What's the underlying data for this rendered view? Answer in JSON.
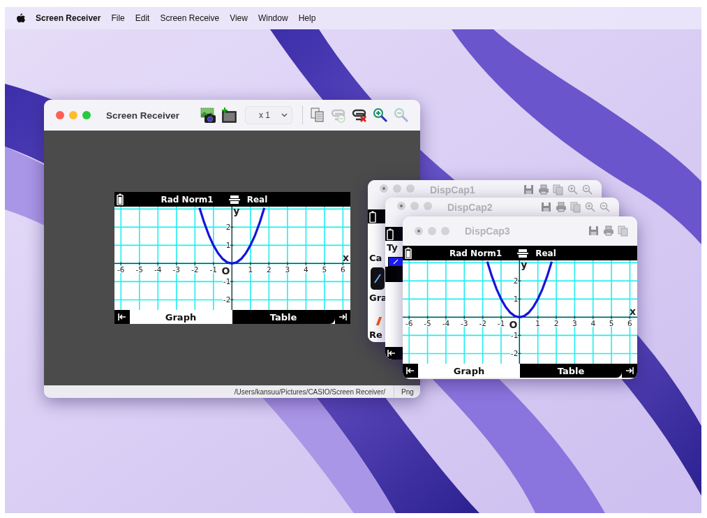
{
  "menu_bar": {
    "app": "Screen Receiver",
    "items": [
      "File",
      "Edit",
      "Screen Receive",
      "View",
      "Window",
      "Help"
    ]
  },
  "main_window": {
    "title": "Screen Receiver",
    "active": true,
    "capture_buttons": [
      {
        "disabled": false
      },
      {
        "disabled": false
      }
    ],
    "zoom_select": "x 1",
    "tools": [
      {
        "disabled": false
      },
      {
        "disabled": true
      },
      {
        "disabled": false
      },
      {
        "disabled": false
      },
      {
        "disabled": true
      }
    ],
    "screen": {
      "status_left": "Rad Norm1",
      "status_right": "Real",
      "tabs": [
        {
          "label": "Graph",
          "selected": true
        },
        {
          "label": "Table",
          "selected": false
        }
      ],
      "chart_data": {
        "type": "line",
        "xlabel": "x",
        "ylabel": "y",
        "x": [
          -1.75,
          -1.5,
          -1.25,
          -1,
          -0.75,
          -0.5,
          -0.25,
          0,
          0.25,
          0.5,
          0.75,
          1,
          1.25,
          1.5,
          1.75
        ],
        "series": [
          {
            "color": "#1414dc",
            "values": [
              3.06,
              2.25,
              1.56,
              1,
              0.56,
              0.25,
              0.06,
              0,
              0.06,
              0.25,
              0.56,
              1,
              1.56,
              2.25,
              3.06
            ]
          }
        ],
        "xlim": [
          -6.35,
          6.4
        ],
        "ylim": [
          -2.56,
          3.13
        ],
        "xticks": [
          -6,
          -5,
          -4,
          -3,
          -2,
          -1,
          1,
          2,
          3,
          4,
          5,
          6
        ],
        "yticks": [
          -2,
          -1,
          1,
          2
        ],
        "grid": true,
        "annotations": [
          {
            "text": "O",
            "x": 0,
            "y": 0
          }
        ]
      }
    },
    "status_path": "/Users/kansuu/Pictures/CASIO/Screen Receiver/",
    "status_format": "Png"
  },
  "disp_windows": [
    {
      "title": "DispCap1",
      "active": false,
      "show_zoom": true,
      "fragments": [
        {
          "kind": "band"
        },
        {
          "kind": "text",
          "text": "Ca"
        },
        {
          "kind": "tile"
        },
        {
          "kind": "text",
          "text": "Gra"
        },
        {
          "kind": "mark"
        },
        {
          "kind": "text",
          "text": "Re"
        }
      ]
    },
    {
      "title": "DispCap2",
      "active": false,
      "show_zoom": true,
      "fragments": [
        {
          "kind": "band"
        },
        {
          "kind": "text",
          "text": "Ty"
        },
        {
          "kind": "selection"
        },
        {
          "kind": "bottom"
        }
      ]
    },
    {
      "title": "DispCap3",
      "active": false,
      "show_zoom": false,
      "screen": {
        "status_left": "Rad Norm1",
        "status_right": "Real",
        "tabs": [
          {
            "label": "Graph",
            "selected": true
          },
          {
            "label": "Table",
            "selected": false
          }
        ],
        "chart_data": {
          "type": "line",
          "xlabel": "x",
          "ylabel": "y",
          "x": [
            -1.75,
            -1.5,
            -1.25,
            -1,
            -0.75,
            -0.5,
            -0.25,
            0,
            0.25,
            0.5,
            0.75,
            1,
            1.25,
            1.5,
            1.75
          ],
          "series": [
            {
              "color": "#1414dc",
              "values": [
                3.06,
                2.25,
                1.56,
                1,
                0.56,
                0.25,
                0.06,
                0,
                0.06,
                0.25,
                0.56,
                1,
                1.56,
                2.25,
                3.06
              ]
            }
          ],
          "xlim": [
            -6.35,
            6.4
          ],
          "ylim": [
            -2.56,
            3.13
          ],
          "xticks": [
            -6,
            -5,
            -4,
            -3,
            -2,
            -1,
            1,
            2,
            3,
            4,
            5,
            6
          ],
          "yticks": [
            -2,
            -1,
            1,
            2
          ],
          "grid": true,
          "annotations": [
            {
              "text": "O",
              "x": 0,
              "y": 0
            }
          ]
        }
      }
    }
  ]
}
